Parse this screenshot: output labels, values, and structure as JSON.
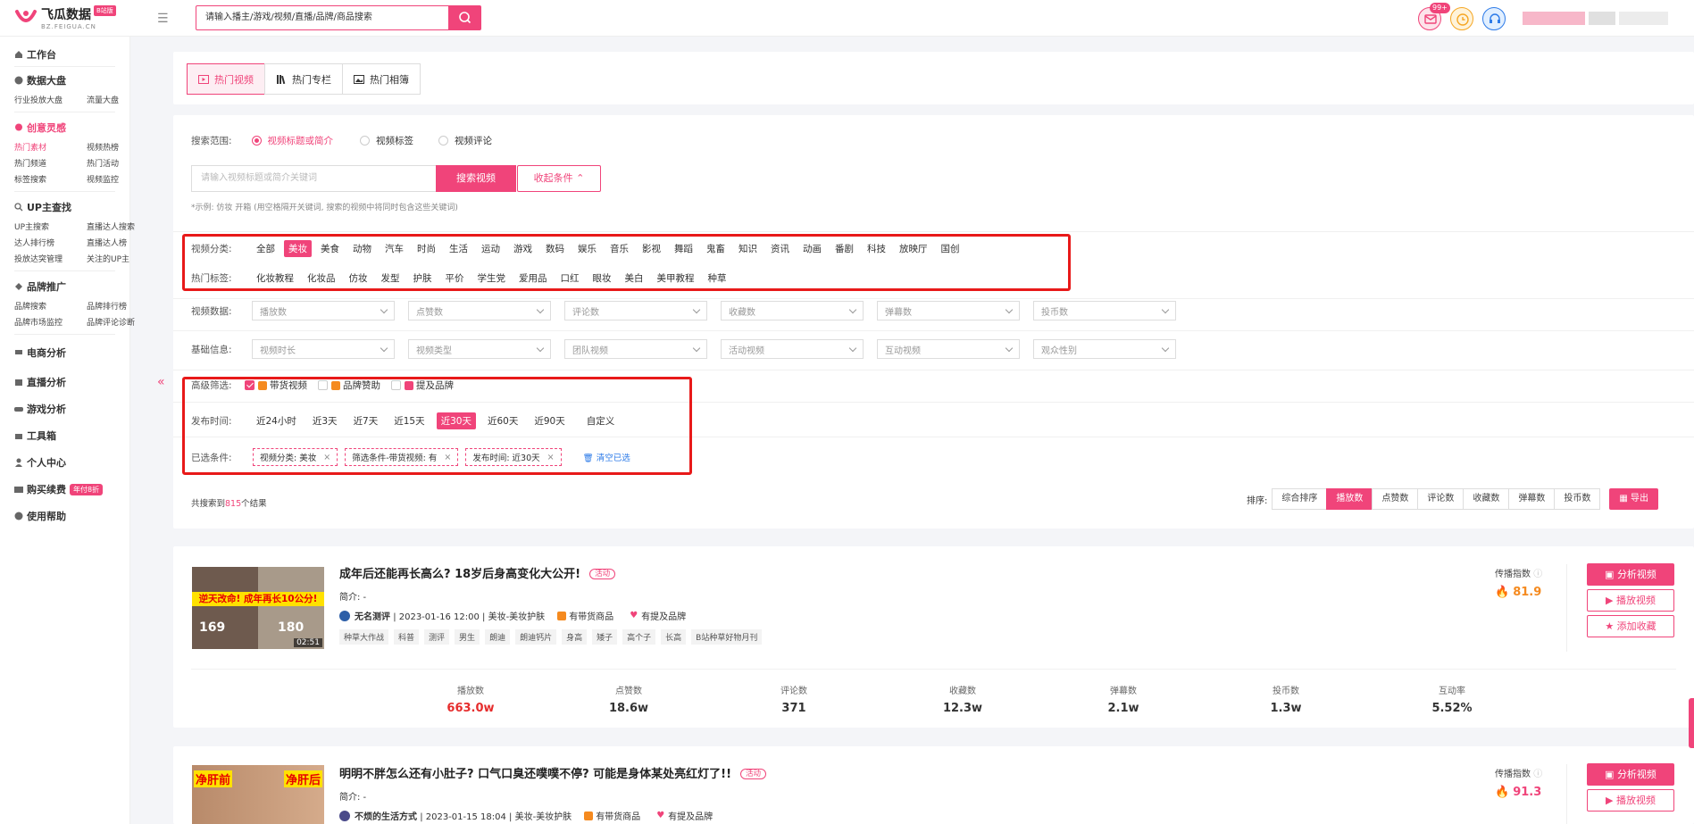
{
  "header": {
    "logo_name": "飞瓜数据",
    "logo_badge": "B站版",
    "logo_sub": "BZ.FEIGUA.CN",
    "search_value": "请输入播主/游戏/视频/直播/品牌/商品搜索",
    "msg_badge": "99+"
  },
  "sidebar": {
    "workbench": "工作台",
    "sections": [
      {
        "title": "数据大盘",
        "items": [
          "行业投放大盘",
          "流量大盘"
        ]
      },
      {
        "title": "创意灵感",
        "items": [
          "热门素材",
          "视频热榜",
          "热门频道",
          "热门活动",
          "标签搜索",
          "视频监控"
        ]
      },
      {
        "title": "UP主查找",
        "items": [
          "UP主搜索",
          "直播达人搜索",
          "达人排行榜",
          "直播达人榜",
          "投放达突管理",
          "关注的UP主"
        ]
      },
      {
        "title": "品牌推广",
        "items": [
          "品牌搜索",
          "品牌排行榜",
          "品牌市场监控",
          "品牌评论诊断"
        ]
      }
    ],
    "singles": [
      "电商分析",
      "直播分析",
      "游戏分析",
      "工具箱",
      "个人中心",
      "购买续费",
      "使用帮助"
    ],
    "promo_badge": "年付8折"
  },
  "tabs": [
    "热门视频",
    "热门专栏",
    "热门相簿"
  ],
  "search": {
    "scope_label": "搜索范围:",
    "scopes": [
      "视频标题或简介",
      "视频标签",
      "视频评论"
    ],
    "keyword_placeholder": "请输入视频标题或简介关键词",
    "search_button": "搜索视频",
    "fold_button": "收起条件 ⌃",
    "hint": "*示例: 仿妆 开箱 (用空格隔开关键词, 搜索的视频中将同时包含这些关键词)"
  },
  "filters": {
    "category_label": "视频分类:",
    "categories": [
      "全部",
      "美妆",
      "美食",
      "动物",
      "汽车",
      "时尚",
      "生活",
      "运动",
      "游戏",
      "数码",
      "娱乐",
      "音乐",
      "影视",
      "舞蹈",
      "鬼畜",
      "知识",
      "资讯",
      "动画",
      "番剧",
      "科技",
      "放映厅",
      "国创"
    ],
    "hot_tag_label": "热门标签:",
    "hot_tags": [
      "化妆教程",
      "化妆品",
      "仿妆",
      "发型",
      "护肤",
      "平价",
      "学生党",
      "爱用品",
      "口红",
      "眼妆",
      "美白",
      "美甲教程",
      "种草"
    ],
    "data_label": "视频数据:",
    "data_selects": [
      "播放数",
      "点赞数",
      "评论数",
      "收藏数",
      "弹幕数",
      "投币数"
    ],
    "basic_label": "基础信息:",
    "basic_selects": [
      "视频时长",
      "视频类型",
      "团队视频",
      "活动视频",
      "互动视频",
      "观众性别"
    ],
    "adv_label": "高级筛选:",
    "adv_options": [
      "带货视频",
      "品牌赞助",
      "提及品牌"
    ],
    "time_label": "发布时间:",
    "times": [
      "近24小时",
      "近3天",
      "近7天",
      "近15天",
      "近30天",
      "近60天",
      "近90天",
      "自定义"
    ],
    "selected_label": "已选条件:",
    "selected": [
      "视频分类: 美妆",
      "筛选条件-带货视频: 有",
      "发布时间: 近30天"
    ],
    "clear": "清空已选"
  },
  "results": {
    "count_prefix": "共搜索到",
    "count": "815",
    "count_suffix": "个结果",
    "sort_label": "排序:",
    "sorts": [
      "综合排序",
      "播放数",
      "点赞数",
      "评论数",
      "收藏数",
      "弹幕数",
      "投币数"
    ],
    "export": "导出"
  },
  "videos": [
    {
      "title": "成年后还能再长高么? 18岁后身高变化大公开!",
      "badge": "活动",
      "intro": "简介: -",
      "author": "无名测评",
      "meta": "| 2023-01-16 12:00 | 美妆-美妆护肤",
      "goods": "有带货商品",
      "brand": "有提及品牌",
      "tags": [
        "种草大作战",
        "科普",
        "测评",
        "男生",
        "朗迪",
        "朗迪钙片",
        "身高",
        "矮子",
        "高个子",
        "长高",
        "B站种草好物月刊"
      ],
      "duration": "02:51",
      "thumb_text": "逆天改命! 成年再长10公分!",
      "thumb_n1": "169",
      "thumb_n2": "180",
      "index_label": "传播指数",
      "index": "81.9",
      "stats": [
        {
          "k": "播放数",
          "v": "663.0w"
        },
        {
          "k": "点赞数",
          "v": "18.6w"
        },
        {
          "k": "评论数",
          "v": "371"
        },
        {
          "k": "收藏数",
          "v": "12.3w"
        },
        {
          "k": "弹幕数",
          "v": "2.1w"
        },
        {
          "k": "投币数",
          "v": "1.3w"
        },
        {
          "k": "互动率",
          "v": "5.52%"
        }
      ]
    },
    {
      "title": "明明不胖怎么还有小肚子? 口气口臭还噗噗不停? 可能是身体某处亮红灯了!!",
      "badge": "活动",
      "intro": "简介: -",
      "author": "不烦的生活方式",
      "meta": "| 2023-01-15 18:04 | 美妆-美妆护肤",
      "goods": "有带货商品",
      "brand": "有提及品牌",
      "thumb_l": "净肝前",
      "thumb_r": "净肝后",
      "index_label": "传播指数",
      "index": "91.3"
    }
  ],
  "actions": {
    "analyze": "分析视频",
    "play": "播放视频",
    "fav": "添加收藏"
  }
}
